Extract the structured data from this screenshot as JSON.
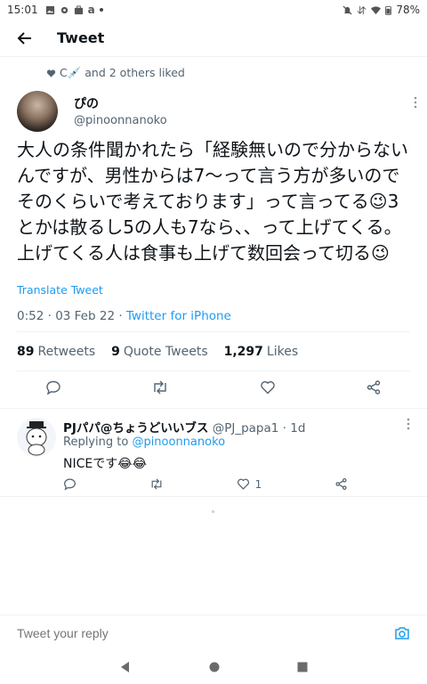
{
  "status_bar": {
    "time": "15:01",
    "battery": "78%"
  },
  "app_bar": {
    "title": "Tweet"
  },
  "liked_line": {
    "names": "C💉 and 2 others liked"
  },
  "tweet": {
    "display_name": "ぴの",
    "handle": "@pinoonnanoko",
    "text": "大人の条件聞かれたら「経験無いので分からないんですが、男性からは7〜って言う方が多いのでそのくらいで考えております」って言ってる😉3とかは散るし5の人も7なら、、って上げてくる。上げてくる人は食事も上げて数回会って切る😉",
    "translate_label": "Translate Tweet",
    "timestamp": "0:52 · 03 Feb 22 · ",
    "source": "Twitter for iPhone",
    "retweets_count": "89",
    "retweets_label": "Retweets",
    "quotes_count": "9",
    "quotes_label": "Quote Tweets",
    "likes_count": "1,297",
    "likes_label": "Likes"
  },
  "reply": {
    "display_name": "PJパパ@ちょうどいいブス",
    "handle_time": "@PJ_papa1 · 1d",
    "replying_prefix": "Replying to ",
    "replying_to": "@pinoonnanoko",
    "text": "NICEです😂😂",
    "likes": "1"
  },
  "composer": {
    "placeholder": "Tweet your reply"
  },
  "colors": {
    "accent": "#1d9bf0",
    "secondary": "#536471",
    "divider": "#eff3f4"
  }
}
